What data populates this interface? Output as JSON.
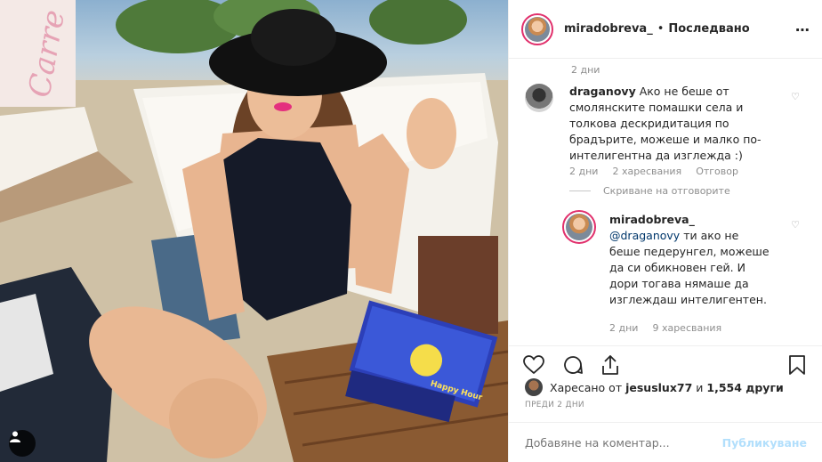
{
  "header": {
    "username": "miradobreva_",
    "separator": "•",
    "follow_label": "Последвано",
    "more_icon": "⋯"
  },
  "comments": {
    "top_time": "2 дни",
    "first": {
      "username": "draganovy",
      "text": "Ако не беше от смолянските помашки села и толкова дескридитация по брадърите, можеше и малко по-интелигентна да изглежда :)",
      "time": "2 дни",
      "likes": "2 харесвания",
      "reply_label": "Отговор"
    },
    "hide_replies_label": "Скриване на отговорите",
    "reply": {
      "username": "miradobreva_",
      "mention": "@draganovy",
      "text": "ти ако не беше педерунгел, можеше да си обикновен гей. И дори тогава нямаше да изглеждаш интелигентен.",
      "time": "2 дни",
      "likes": "9 харесвания"
    }
  },
  "likes": {
    "prefix": "Харесано от",
    "user": "jesuslux77",
    "conjunction": "и",
    "count": "1,554 други"
  },
  "post_time": "ПРЕДИ 2 ДНИ",
  "add_comment": {
    "placeholder": "Добавяне на коментар...",
    "publish_label": "Публикуване"
  },
  "photo": {
    "sign_text": "Carre",
    "book_title": "Happy Hour"
  }
}
